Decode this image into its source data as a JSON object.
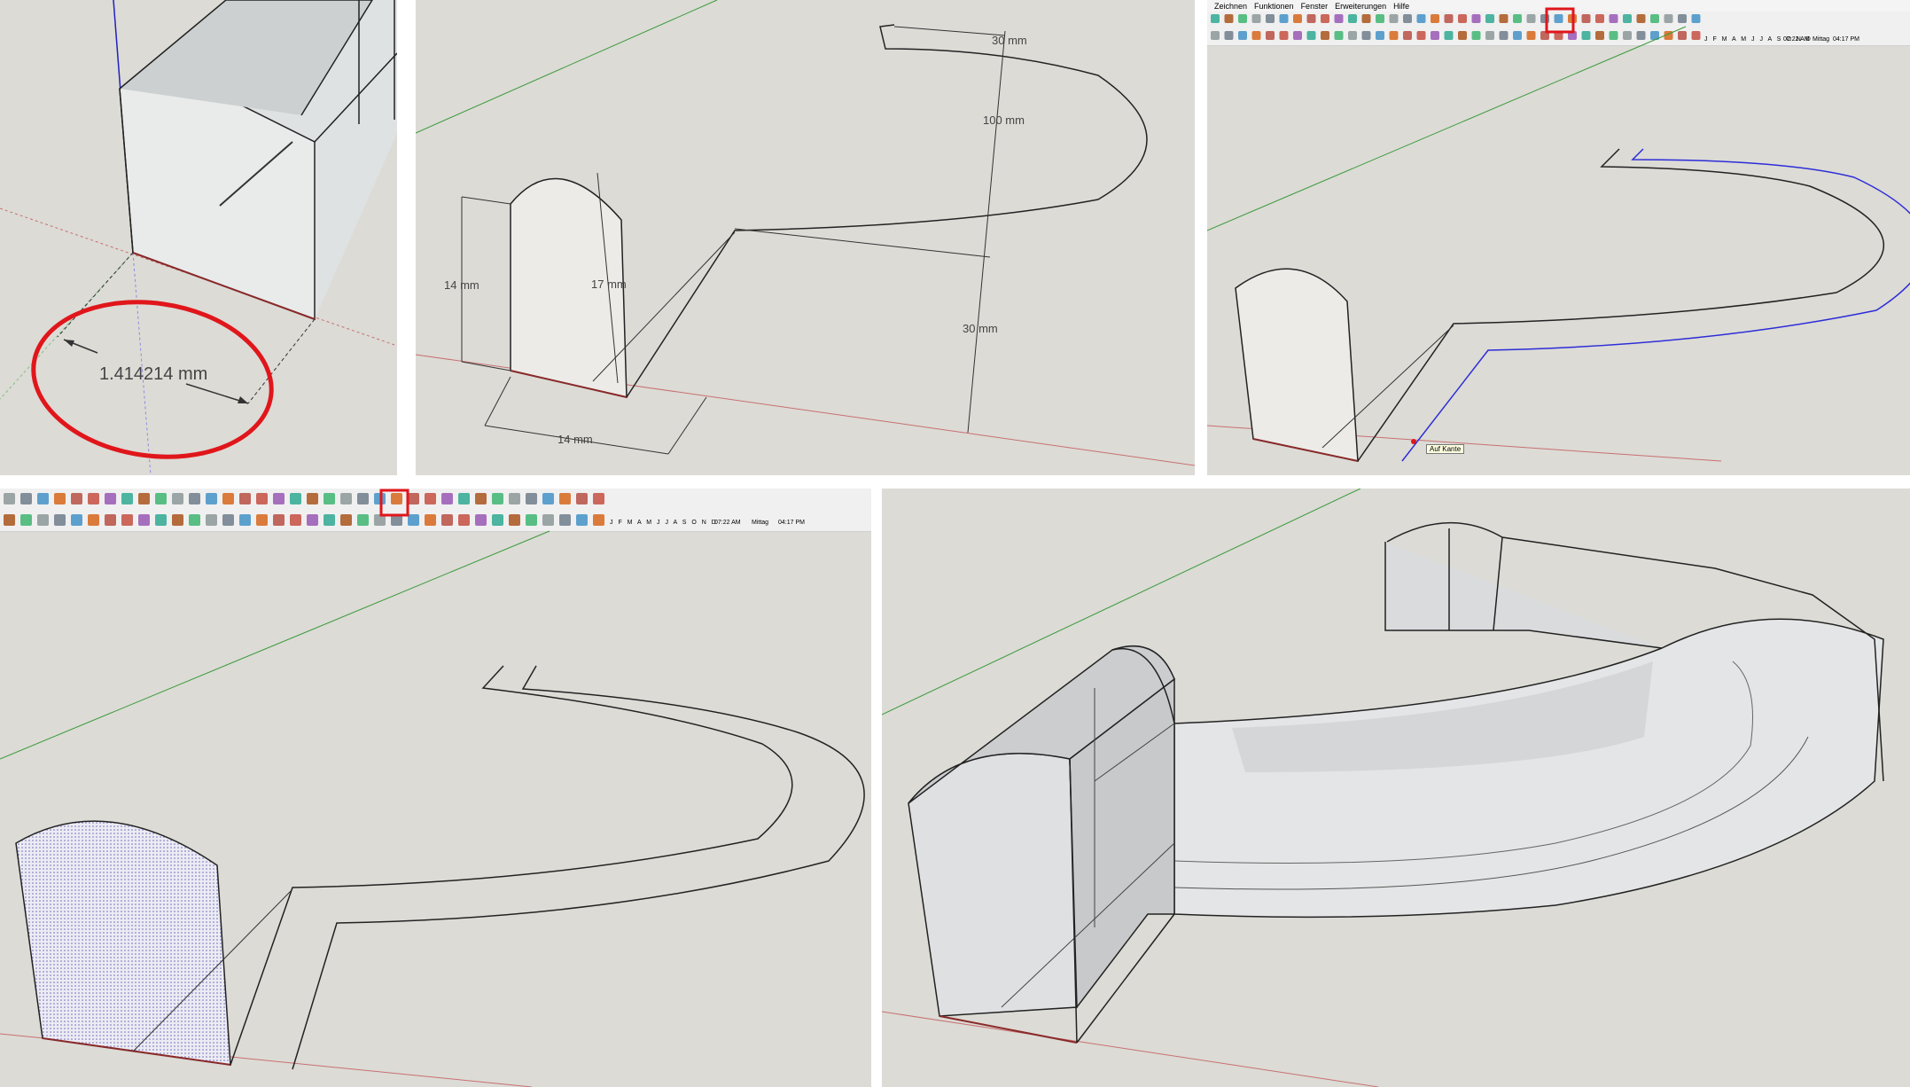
{
  "panel1": {
    "dimension_label": "1.414214 mm"
  },
  "panel2": {
    "dimensions": {
      "d_top": "30 mm",
      "d_radius": "100 mm",
      "d_right": "30 mm",
      "d_left_height": "14 mm",
      "d_arch_height": "17 mm",
      "d_bottom_width": "14 mm"
    }
  },
  "panel3": {
    "menu": [
      "Zeichnen",
      "Funktionen",
      "Fenster",
      "Erweiterungen",
      "Hilfe"
    ],
    "tooltip": "Auf Kante",
    "shadow_months": "J F M A M J J A S O N D",
    "time_start": "07:22 AM",
    "time_mid": "Mittag",
    "time_end": "04:17 PM",
    "highlighted_tool": "follow-me-tool"
  },
  "panel4": {
    "shadow_months": "J F M A M J J A S O N D",
    "time_start": "07:22 AM",
    "time_mid": "Mittag",
    "time_end": "04:17 PM",
    "highlighted_tool": "follow-me-tool"
  },
  "colors": {
    "canvas": "#dcdbd6",
    "highlight": "#e0161b",
    "red_axis": "#b04040",
    "green_axis": "#3a9a3a",
    "blue_axis": "#2020c0",
    "selected_path": "#2c2cd8"
  }
}
